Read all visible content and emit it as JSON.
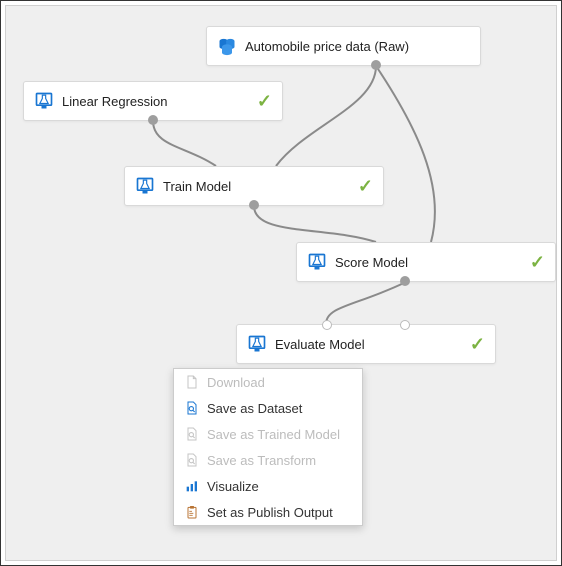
{
  "nodes": {
    "data": {
      "label": "Automobile price data (Raw)"
    },
    "linreg": {
      "label": "Linear Regression"
    },
    "train": {
      "label": "Train Model"
    },
    "score": {
      "label": "Score Model"
    },
    "eval": {
      "label": "Evaluate Model"
    }
  },
  "menu": {
    "download": "Download",
    "save_dataset": "Save as Dataset",
    "save_trained": "Save as Trained Model",
    "save_transform": "Save as Transform",
    "visualize": "Visualize",
    "publish": "Set as Publish Output"
  }
}
